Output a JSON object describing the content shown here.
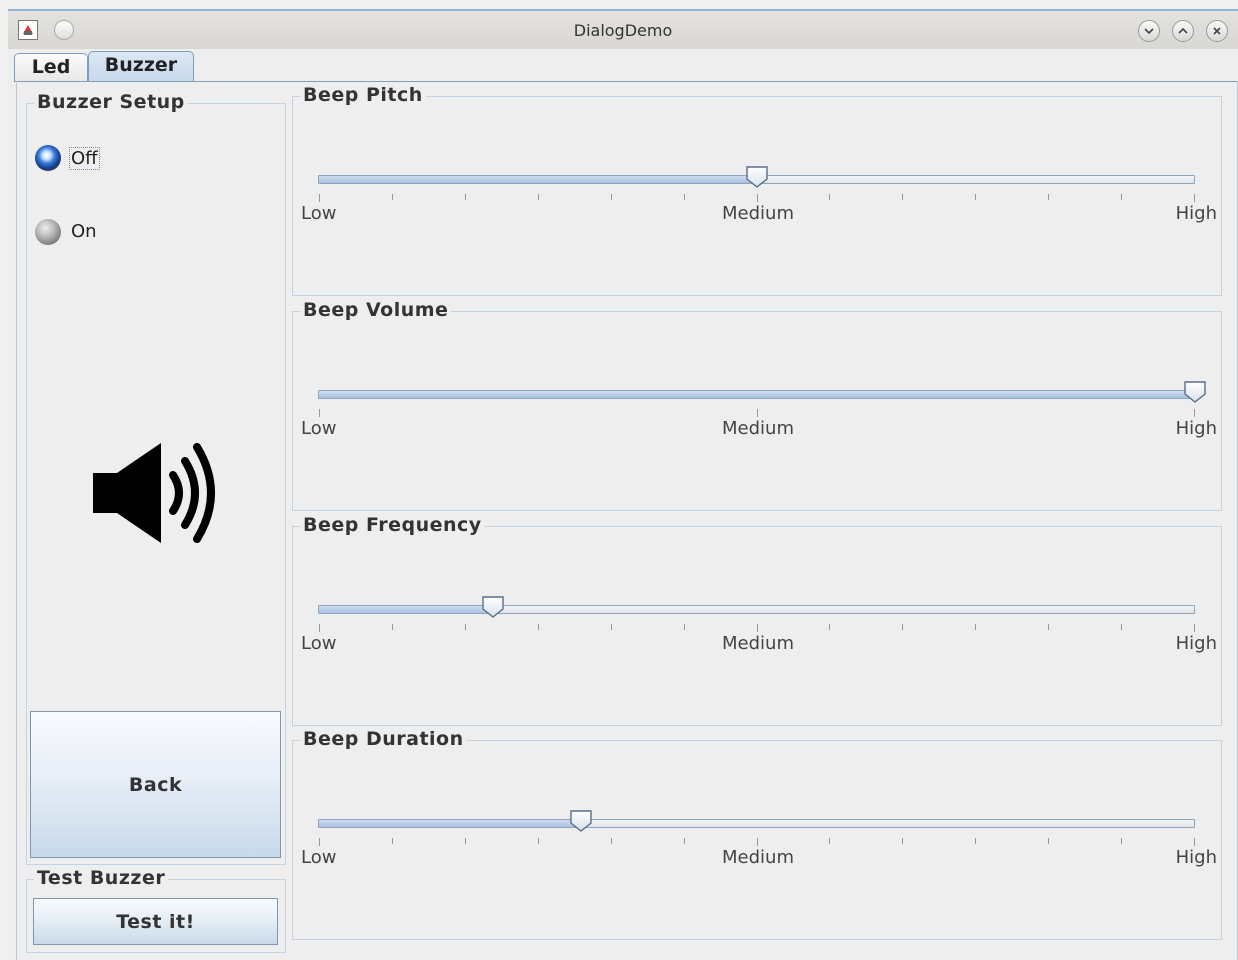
{
  "window": {
    "title": "DialogDemo"
  },
  "tabs": [
    {
      "label": "Led",
      "active": false
    },
    {
      "label": "Buzzer",
      "active": true
    }
  ],
  "buzzer_setup": {
    "title": "Buzzer Setup",
    "options": [
      {
        "label": "Off",
        "selected": true
      },
      {
        "label": "On",
        "selected": false
      }
    ],
    "icon": "speaker-volume-icon",
    "back_label": "Back"
  },
  "test_buzzer": {
    "title": "Test Buzzer",
    "button_label": "Test it!"
  },
  "sliders": [
    {
      "title": "Beep Pitch",
      "value": 0.5,
      "ticks": "major-minor",
      "low": "Low",
      "medium": "Medium",
      "high": "High"
    },
    {
      "title": "Beep Volume",
      "value": 1.0,
      "ticks": "major",
      "low": "Low",
      "medium": "Medium",
      "high": "High"
    },
    {
      "title": "Beep Frequency",
      "value": 0.2,
      "ticks": "major-minor",
      "low": "Low",
      "medium": "Medium",
      "high": "High"
    },
    {
      "title": "Beep Duration",
      "value": 0.3,
      "ticks": "major-minor",
      "low": "Low",
      "medium": "Medium",
      "high": "High"
    }
  ],
  "colors": {
    "accent": "#7f9db9",
    "selected_tab": "#c5d8ec"
  }
}
